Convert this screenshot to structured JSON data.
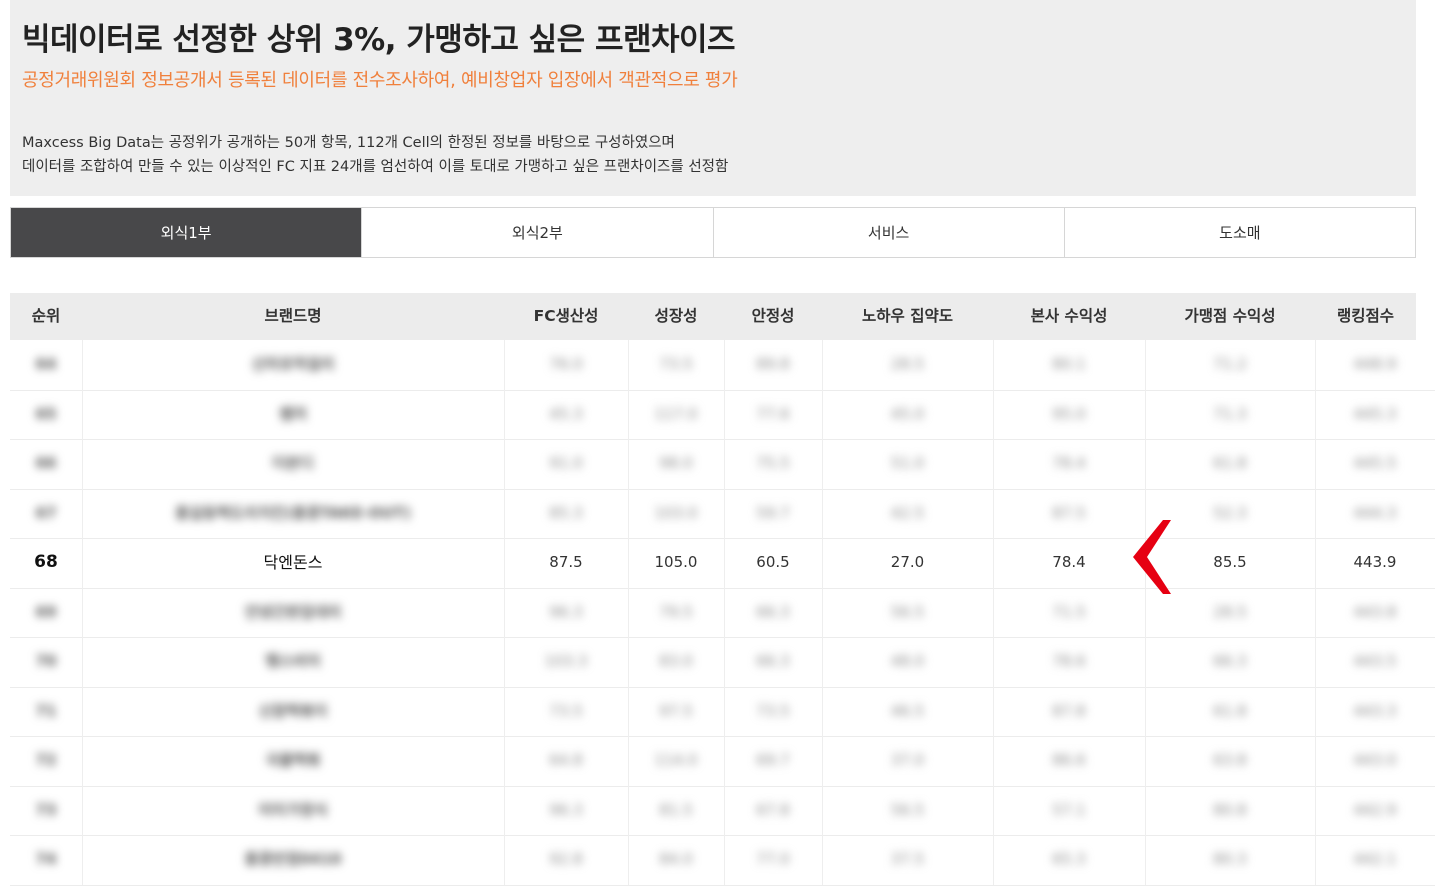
{
  "header": {
    "title": "빅데이터로 선정한 상위 3%, 가맹하고 싶은 프랜차이즈",
    "subtitle": "공정거래위원회 정보공개서 등록된 데이터를 전수조사하여, 예비창업자 입장에서 객관적으로 평가",
    "desc_line1": "Maxcess Big Data는 공정위가 공개하는 50개 항목, 112개 Cell의 한정된 정보를 바탕으로 구성하였으며",
    "desc_line2": "데이터를 조합하여 만들 수 있는 이상적인 FC 지표 24개를 엄선하여 이를 토대로 가맹하고 싶은 프랜차이즈를 선정함"
  },
  "tabs": [
    {
      "label": "외식1부",
      "active": true
    },
    {
      "label": "외식2부",
      "active": false
    },
    {
      "label": "서비스",
      "active": false
    },
    {
      "label": "도소매",
      "active": false
    }
  ],
  "table": {
    "headers": [
      "순위",
      "브랜드명",
      "FC생산성",
      "성장성",
      "안정성",
      "노하우 집약도",
      "본사 수익성",
      "가맹점 수익성",
      "랭킹점수"
    ],
    "rows": [
      {
        "rank": "64",
        "brand": "신마포막걸리",
        "fc": "76.0",
        "growth": "73.5",
        "stability": "89.8",
        "knowhow": "28.5",
        "hq": "80.1",
        "franchisee": "71.2",
        "score": "448.9",
        "blurred": true
      },
      {
        "rank": "65",
        "brand": "쌤저",
        "fc": "45.3",
        "growth": "117.0",
        "stability": "77.6",
        "knowhow": "45.0",
        "hq": "95.0",
        "franchisee": "71.3",
        "score": "445.3",
        "blurred": true
      },
      {
        "rank": "66",
        "brand": "더본디",
        "fc": "91.0",
        "growth": "98.0",
        "stability": "75.5",
        "knowhow": "51.0",
        "hq": "78.4",
        "franchisee": "61.8",
        "score": "445.5",
        "blurred": true
      },
      {
        "rank": "67",
        "brand": "홍길동떡도리치킨(홍콩TAKE-OUT)",
        "fc": "85.3",
        "growth": "103.0",
        "stability": "59.7",
        "knowhow": "42.5",
        "hq": "87.5",
        "franchisee": "52.3",
        "score": "444.3",
        "blurred": true
      },
      {
        "rank": "68",
        "brand": "닥엔돈스",
        "fc": "87.5",
        "growth": "105.0",
        "stability": "60.5",
        "knowhow": "27.0",
        "hq": "78.4",
        "franchisee": "85.5",
        "score": "443.9",
        "blurred": false
      },
      {
        "rank": "69",
        "brand": "안녕간판집대리",
        "fc": "96.3",
        "growth": "79.5",
        "stability": "66.3",
        "knowhow": "56.5",
        "hq": "71.5",
        "franchisee": "28.5",
        "score": "443.8",
        "blurred": true
      },
      {
        "rank": "70",
        "brand": "땡스비어",
        "fc": "103.3",
        "growth": "83.0",
        "stability": "66.3",
        "knowhow": "48.0",
        "hq": "78.6",
        "franchisee": "66.3",
        "score": "443.5",
        "blurred": true
      },
      {
        "rank": "71",
        "brand": "신참떡볶이",
        "fc": "73.5",
        "growth": "97.5",
        "stability": "73.5",
        "knowhow": "46.5",
        "hq": "87.8",
        "franchisee": "61.8",
        "score": "443.3",
        "blurred": true
      },
      {
        "rank": "72",
        "brand": "국물떡볶",
        "fc": "64.8",
        "growth": "114.0",
        "stability": "69.7",
        "knowhow": "37.0",
        "hq": "86.6",
        "franchisee": "63.8",
        "score": "443.0",
        "blurred": true
      },
      {
        "rank": "73",
        "brand": "미미가정식",
        "fc": "96.3",
        "growth": "81.5",
        "stability": "67.8",
        "knowhow": "56.5",
        "hq": "57.1",
        "franchisee": "80.8",
        "score": "442.9",
        "blurred": true
      },
      {
        "rank": "74",
        "brand": "홍콩반점0410",
        "fc": "92.8",
        "growth": "84.0",
        "stability": "77.0",
        "knowhow": "37.5",
        "hq": "65.3",
        "franchisee": "80.3",
        "score": "442.1",
        "blurred": true
      }
    ]
  },
  "colors": {
    "header_bg": "#eeeeee",
    "subtitle": "#f0803c",
    "active_tab": "#48484a",
    "marker": "#e60012"
  },
  "icons": {
    "marker": "left-chevron-marker-icon"
  }
}
